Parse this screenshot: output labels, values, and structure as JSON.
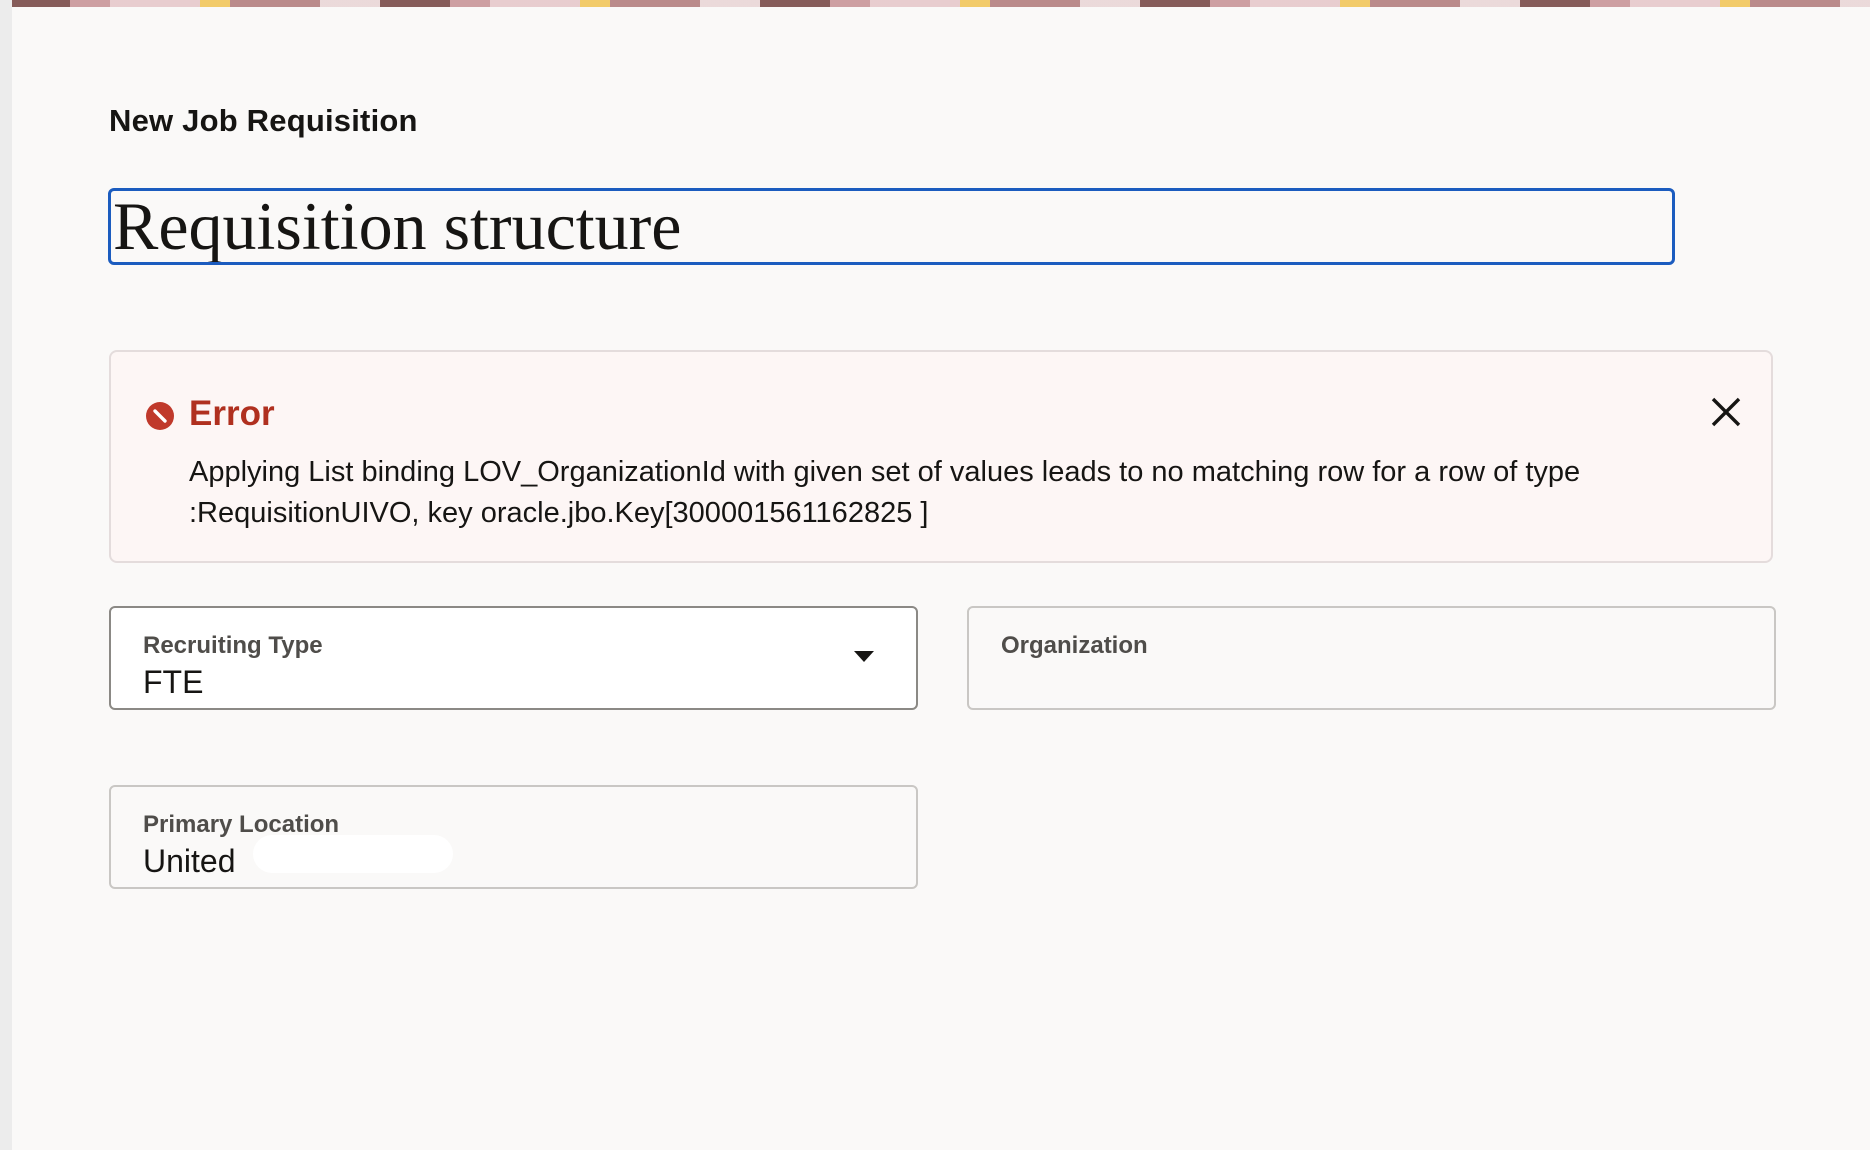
{
  "page": {
    "overline": "New Job Requisition",
    "title_value": "Requisition structure"
  },
  "error": {
    "title": "Error",
    "message": "Applying List binding LOV_OrganizationId with given set of values leads to no matching row for a row of type :RequisitionUIVO, key oracle.jbo.Key[300001561162825 ]",
    "icon": "error-circle-icon",
    "close_icon": "close-icon",
    "color": "#b0301f"
  },
  "fields": {
    "recruiting_type": {
      "label": "Recruiting Type",
      "value": "FTE"
    },
    "organization": {
      "label": "Organization",
      "value": ""
    },
    "primary_location": {
      "label": "Primary Location",
      "value": "United"
    }
  },
  "colors": {
    "focus_border": "#1b5cbf",
    "error_bg": "#fdf6f5"
  }
}
